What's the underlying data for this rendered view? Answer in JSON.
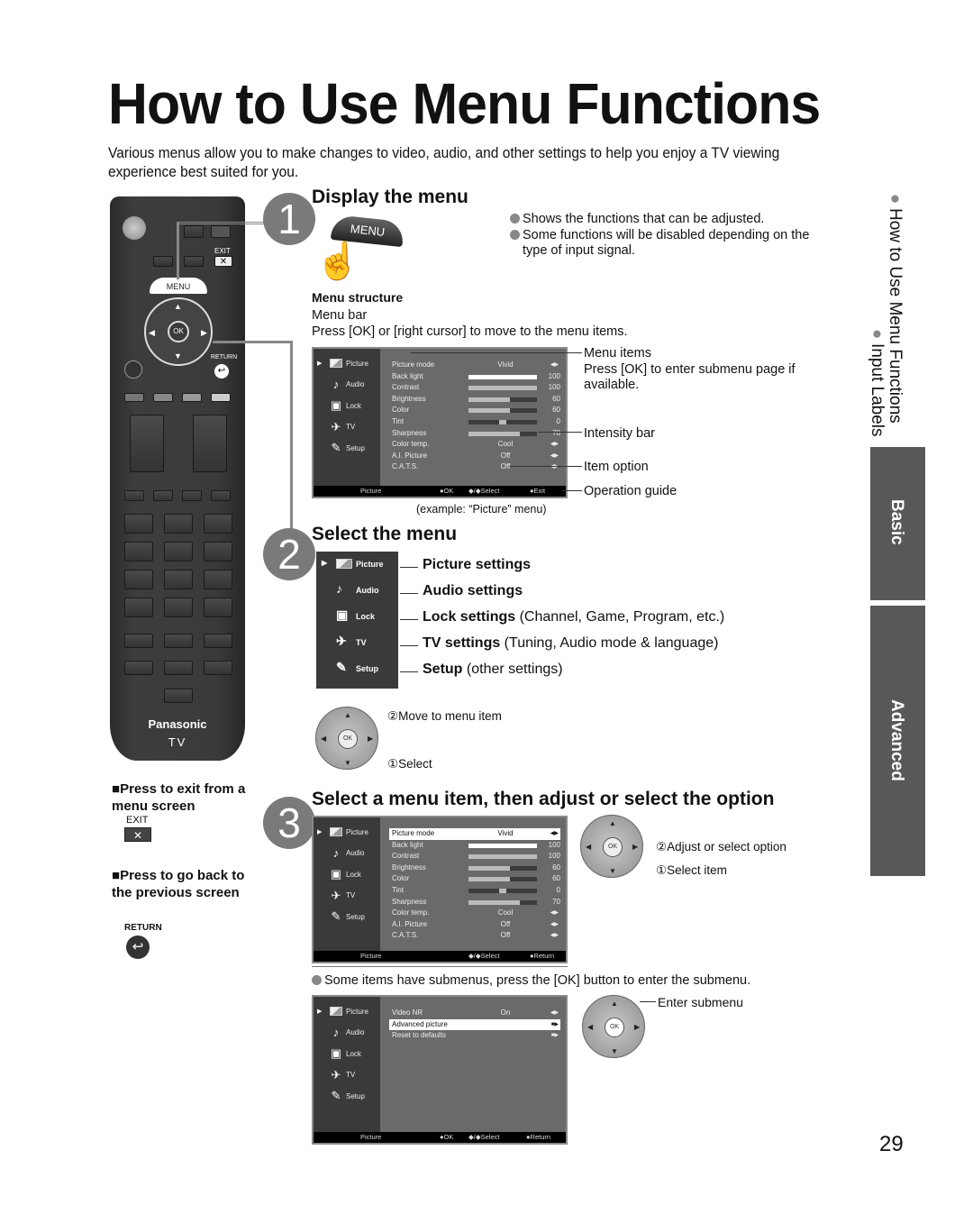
{
  "page": {
    "title": "How to Use Menu Functions",
    "intro": "Various menus allow you to make changes to video, audio, and other settings to help you enjoy a TV viewing experience best suited for you.",
    "page_number": "29"
  },
  "sidebar": {
    "breadcrumb_1": "How to Use Menu Functions",
    "breadcrumb_2": "Input Labels",
    "tabs": [
      {
        "label": "Basic"
      },
      {
        "label": "Advanced"
      }
    ]
  },
  "remote": {
    "menu_label": "MENU",
    "exit_label": "EXIT",
    "ok_label": "OK",
    "return_label": "RETURN",
    "brand": "Panasonic",
    "model": "TV"
  },
  "step1": {
    "number": "1",
    "heading": "Display the menu",
    "menu_button_label": "MENU",
    "bullets": [
      "Shows the functions that can be adjusted.",
      "Some functions will be disabled depending on the type of input signal."
    ],
    "structure_title": "Menu structure",
    "menu_bar_label": "Menu bar",
    "menu_bar_hint": "Press [OK] or [right cursor] to move to the menu items.",
    "callouts": {
      "menu_items": "Menu items",
      "menu_items_hint": "Press [OK] to enter submenu page if available.",
      "intensity_bar": "Intensity bar",
      "item_option": "Item option",
      "operation_guide": "Operation guide"
    },
    "caption": "(example: “Picture” menu)"
  },
  "osd_sidebar": [
    {
      "label": "Picture",
      "icon": "picture-icon"
    },
    {
      "label": "Audio",
      "icon": "music-note-icon"
    },
    {
      "label": "Lock",
      "icon": "lock-icon"
    },
    {
      "label": "TV",
      "icon": "satellite-icon"
    },
    {
      "label": "Setup",
      "icon": "wrench-icon"
    }
  ],
  "picture_menu": [
    {
      "name": "Picture mode",
      "type": "option",
      "value": "Vivid"
    },
    {
      "name": "Back light",
      "type": "bar",
      "value": 100,
      "fraction": 1.0
    },
    {
      "name": "Contrast",
      "type": "bar",
      "value": 100,
      "fraction": 1.0
    },
    {
      "name": "Brightness",
      "type": "bar",
      "value": 60,
      "fraction": 0.6
    },
    {
      "name": "Color",
      "type": "bar",
      "value": 60,
      "fraction": 0.6
    },
    {
      "name": "Tint",
      "type": "center",
      "value": 0,
      "fraction": 0.5
    },
    {
      "name": "Sharpness",
      "type": "bar",
      "value": 70,
      "fraction": 0.75
    },
    {
      "name": "Color temp.",
      "type": "option",
      "value": "Cool"
    },
    {
      "name": "A.I. Picture",
      "type": "option",
      "value": "Off"
    },
    {
      "name": "C.A.T.S.",
      "type": "option",
      "value": "Off"
    }
  ],
  "guide1": {
    "menu": "Picture",
    "ok": "OK",
    "select": "Select",
    "exit": "Exit"
  },
  "step2": {
    "number": "2",
    "heading": "Select the menu",
    "items": [
      {
        "bold": "Picture settings",
        "rest": ""
      },
      {
        "bold": "Audio settings",
        "rest": ""
      },
      {
        "bold": "Lock settings",
        "rest": " (Channel, Game, Program, etc.)"
      },
      {
        "bold": "TV settings",
        "rest": " (Tuning, Audio mode & language)"
      },
      {
        "bold": "Setup",
        "rest": " (other settings)"
      }
    ],
    "move_label": "②Move to menu item",
    "select_label": "①Select"
  },
  "step3": {
    "number": "3",
    "heading": "Select a menu item, then adjust or select the option",
    "adjust_label": "②Adjust or select option",
    "select_item_label": "①Select item",
    "guide": {
      "menu": "Picture",
      "select": "Select",
      "return": "Return"
    },
    "submenu_note": "Some items have submenus, press the [OK] button to enter the submenu.",
    "enter_submenu": "Enter submenu",
    "submenu": [
      {
        "name": "Video NR",
        "value": "On",
        "arrow": "◆"
      },
      {
        "name": "Advanced picture",
        "value": "",
        "arrow": "▶",
        "selected": true
      },
      {
        "name": "Reset to defaults",
        "value": "",
        "arrow": "▶"
      }
    ],
    "guide2": {
      "menu": "Picture",
      "ok": "OK",
      "select": "Select",
      "return": "Return"
    }
  },
  "tips": {
    "exit_title": "Press to exit from a menu screen",
    "exit_key": "EXIT",
    "back_title": "Press to go back to the previous screen",
    "back_key": "RETURN"
  }
}
